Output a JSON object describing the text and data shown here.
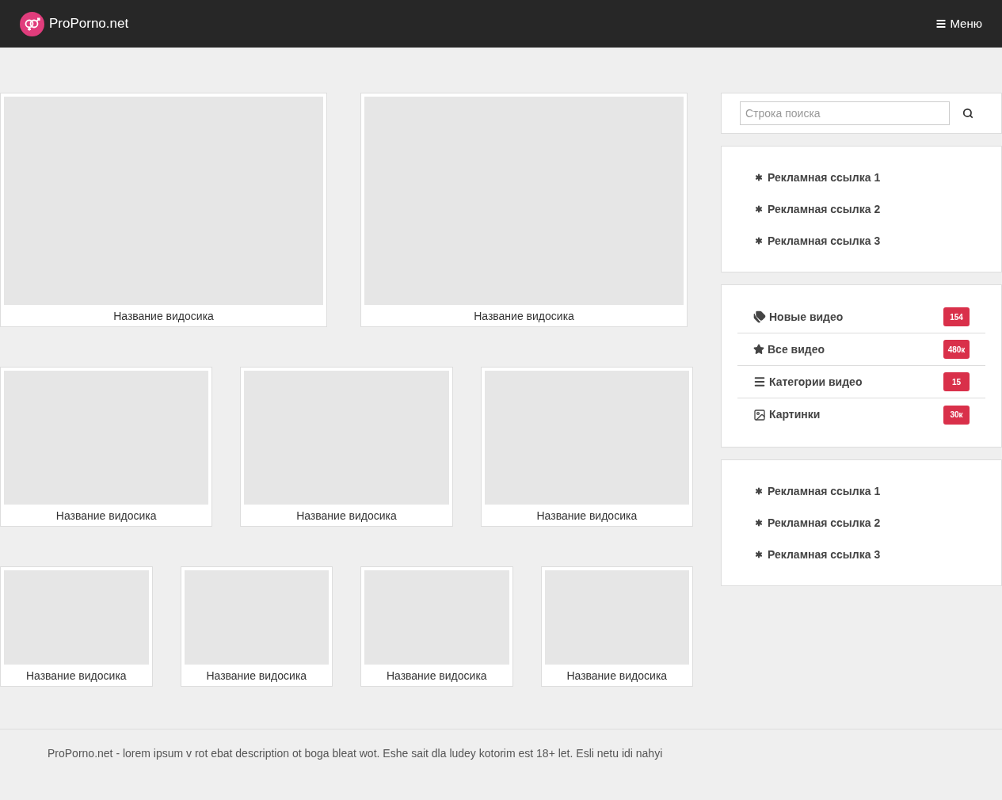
{
  "header": {
    "logo": "ProPorno.net",
    "menu": "Меню"
  },
  "video_rows": [
    {
      "videos": [
        {
          "title": "Название видосика"
        },
        {
          "title": "Название видосика"
        }
      ]
    },
    {
      "videos": [
        {
          "title": "Название видосика"
        },
        {
          "title": "Название видосика"
        },
        {
          "title": "Название видосика"
        }
      ]
    },
    {
      "videos": [
        {
          "title": "Название видосика"
        },
        {
          "title": "Название видосика"
        },
        {
          "title": "Название видосика"
        },
        {
          "title": "Название видосика"
        }
      ]
    }
  ],
  "search": {
    "placeholder": "Строка поиска"
  },
  "ad_links_top": [
    "Рекламная ссылка 1",
    "Рекламная ссылка 2",
    "Рекламная ссылка 3"
  ],
  "nav": [
    {
      "kind": "tags",
      "label": "Новые видео",
      "count": "154"
    },
    {
      "kind": "star",
      "label": "Все видео",
      "count": "480к"
    },
    {
      "kind": "list",
      "label": "Категории видео",
      "count": "15"
    },
    {
      "kind": "image",
      "label": "Картинки",
      "count": "30к"
    }
  ],
  "ad_links_bottom": [
    "Рекламная ссылка 1",
    "Рекламная ссылка 2",
    "Рекламная ссылка 3"
  ],
  "footer": "ProPorno.net - lorem ipsum v rot ebat description ot boga bleat wot. Eshe sait dla ludey kotorim est 18+ let. Esli netu idi nahyi"
}
